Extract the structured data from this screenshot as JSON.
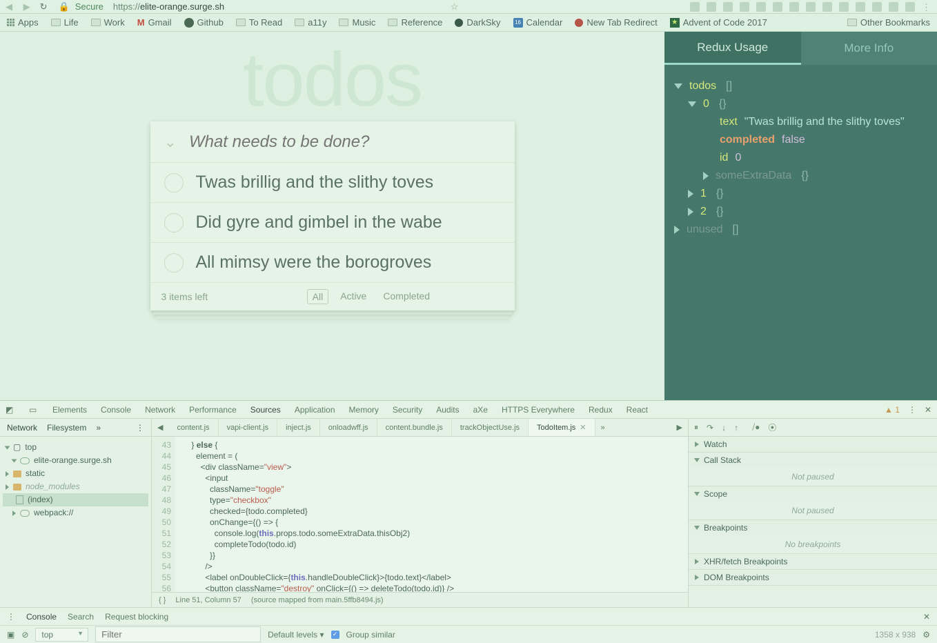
{
  "chrome": {
    "secure_label": "Secure",
    "url_prefix": "https://",
    "url_host": "elite-orange.surge.sh",
    "url_rest": ""
  },
  "bookmarks": {
    "apps": "Apps",
    "items": [
      "Life",
      "Work",
      "Gmail",
      "Github",
      "To Read",
      "a11y",
      "Music",
      "Reference",
      "DarkSky",
      "Calendar",
      "New Tab Redirect",
      "Advent of Code 2017"
    ],
    "cal_num": "16",
    "other": "Other Bookmarks"
  },
  "todoapp": {
    "title": "todos",
    "placeholder": "What needs to be done?",
    "items": [
      "Twas brillig and the slithy toves",
      "Did gyre and gimbel in the wabe",
      "All mimsy were the borogroves"
    ],
    "count_label": "3 items left",
    "filters": {
      "all": "All",
      "active": "Active",
      "completed": "Completed"
    }
  },
  "redux": {
    "tab_usage": "Redux Usage",
    "tab_more": "More Info",
    "root": "todos",
    "idx0": "0",
    "k_text": "text",
    "v_text": "\"Twas brillig and the slithy toves\"",
    "k_completed": "completed",
    "v_completed": "false",
    "k_id": "id",
    "v_id": "0",
    "k_extra": "someExtraData",
    "idx1": "1",
    "idx2": "2",
    "unused": "unused"
  },
  "devtools": {
    "tabs": [
      "Elements",
      "Console",
      "Network",
      "Performance",
      "Sources",
      "Application",
      "Memory",
      "Security",
      "Audits",
      "aXe",
      "HTTPS Everywhere",
      "Redux",
      "React"
    ],
    "active_tab": "Sources",
    "warn_count": "1",
    "left_subtabs": {
      "network": "Network",
      "filesystem": "Filesystem"
    },
    "tree": {
      "top": "top",
      "host": "elite-orange.surge.sh",
      "static": "static",
      "node_modules": "node_modules",
      "index": "(index)",
      "webpack": "webpack://"
    },
    "file_tabs": [
      "content.js",
      "vapi-client.js",
      "inject.js",
      "onloadwff.js",
      "content.bundle.js",
      "trackObjectUse.js",
      "TodoItem.js"
    ],
    "active_file": "TodoItem.js",
    "gutter": [
      "43",
      "44",
      "45",
      "46",
      "47",
      "48",
      "49",
      "50",
      "51",
      "52",
      "53",
      "54",
      "55",
      "56"
    ],
    "code_lines": [
      "    } else {",
      "      element = (",
      "        <div className=\"view\">",
      "          <input",
      "            className=\"toggle\"",
      "            type=\"checkbox\"",
      "            checked={todo.completed}",
      "            onChange={() => {",
      "              console.log(this.props.todo.someExtraData.thisObj2)",
      "              completeTodo(todo.id)",
      "            }}",
      "          />",
      "          <label onDoubleClick={this.handleDoubleClick}>{todo.text}</label>",
      "          <button className=\"destroy\" onClick={() => deleteTodo(todo.id)} />"
    ],
    "status": {
      "pos": "Line 51, Column 57",
      "map": "(source mapped from main.5ffb8494.js)"
    },
    "dbg": {
      "watch": "Watch",
      "callstack": "Call Stack",
      "scope": "Scope",
      "breakpoints": "Breakpoints",
      "xhr": "XHR/fetch Breakpoints",
      "dom": "DOM Breakpoints",
      "not_paused": "Not paused",
      "no_bp": "No breakpoints"
    }
  },
  "console": {
    "tabs": {
      "console": "Console",
      "search": "Search",
      "rb": "Request blocking"
    },
    "context": "top",
    "filter_ph": "Filter",
    "levels": "Default levels ▾",
    "group": "Group similar",
    "dims": "1358 x 938"
  }
}
